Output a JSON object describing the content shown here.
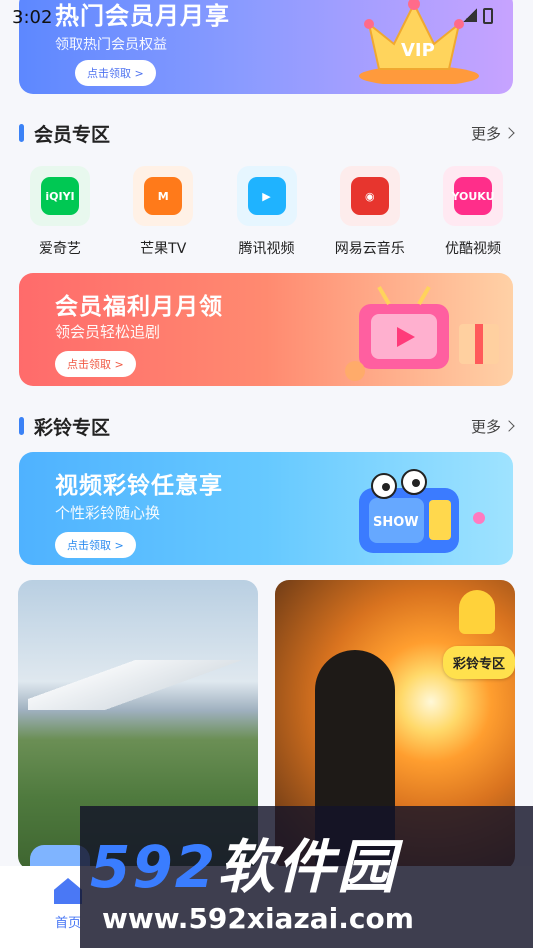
{
  "status_bar": {
    "time": "3:02"
  },
  "top_banner": {
    "title": "热门会员月月享",
    "subtitle": "领取热门会员权益",
    "button": "点击领取 >",
    "crown_text": "VIP"
  },
  "member_section": {
    "title": "会员专区",
    "more": "更多"
  },
  "apps": [
    {
      "label": "爱奇艺",
      "icon_text": "iQIYI",
      "color": "#00c853",
      "bg": "#e8f8ee"
    },
    {
      "label": "芒果TV",
      "icon_text": "M",
      "color": "#ff7a1a",
      "bg": "#fff1e6"
    },
    {
      "label": "腾讯视频",
      "icon_text": "▶",
      "color": "#1fb3ff",
      "bg": "#e6f6ff"
    },
    {
      "label": "网易云音乐",
      "icon_text": "◉",
      "color": "#e7352e",
      "bg": "#fdecec"
    },
    {
      "label": "优酷视频",
      "icon_text": "YOUKU",
      "color": "#ff2e8a",
      "bg": "#ffe9f2"
    }
  ],
  "welfare_banner": {
    "title": "会员福利月月领",
    "subtitle": "领会员轻松追剧",
    "button": "点击领取 >"
  },
  "ring_section": {
    "title": "彩铃专区",
    "more": "更多"
  },
  "ring_banner": {
    "title": "视频彩铃任意享",
    "subtitle": "个性彩铃随心换",
    "button": "点击领取 >",
    "tv_text": "SHOW"
  },
  "cards": {
    "badge": "彩铃专区"
  },
  "tabbar": {
    "home_label": "首页"
  },
  "watermark": {
    "brand_num": "592",
    "brand_text": "软件园",
    "url": "www.592xiazai.com"
  }
}
